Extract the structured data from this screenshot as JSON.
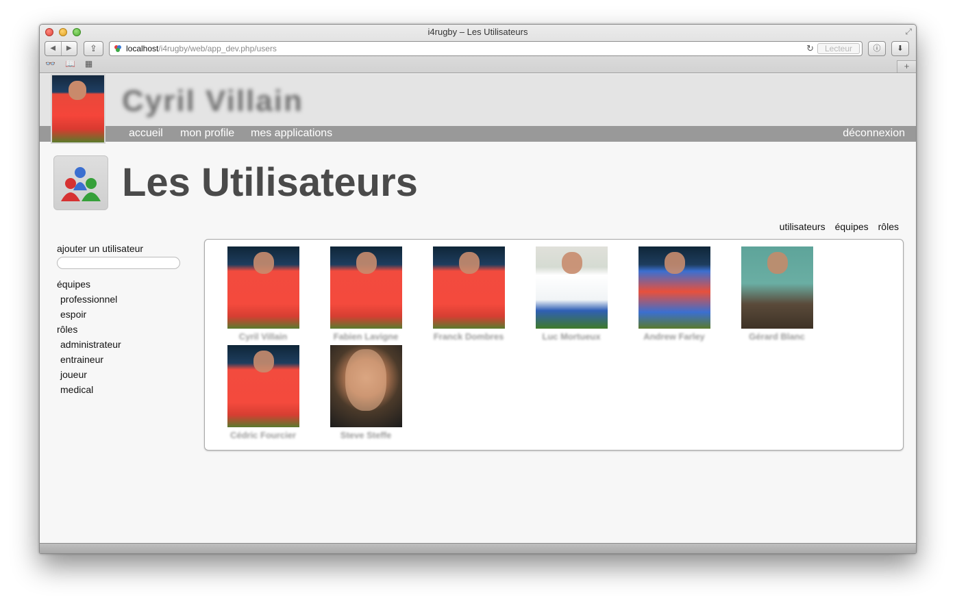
{
  "browser": {
    "window_title": "i4rugby – Les Utilisateurs",
    "url_host": "localhost",
    "url_path": "/i4rugby/web/app_dev.php/users",
    "reader_label": "Lecteur"
  },
  "header": {
    "username": "Cyril Villain",
    "menu": {
      "home": "accueil",
      "profile": "mon profile",
      "apps": "mes applications",
      "logout": "déconnexion"
    }
  },
  "page": {
    "title": "Les Utilisateurs",
    "filters": [
      "utilisateurs",
      "équipes",
      "rôles"
    ]
  },
  "sidebar": {
    "add_user": "ajouter un utilisateur",
    "teams_heading": "équipes",
    "teams": [
      "professionnel",
      "espoir"
    ],
    "roles_heading": "rôles",
    "roles": [
      "administrateur",
      "entraineur",
      "joueur",
      "medical"
    ]
  },
  "users": [
    {
      "name": "Cyril Villain"
    },
    {
      "name": "Fabien Lavigne"
    },
    {
      "name": "Franck Dombres"
    },
    {
      "name": "Luc Mortueux"
    },
    {
      "name": "Andrew Farley"
    },
    {
      "name": "Gérard Blanc"
    },
    {
      "name": "Cédric Fourcier"
    },
    {
      "name": "Steve Steffe"
    }
  ]
}
